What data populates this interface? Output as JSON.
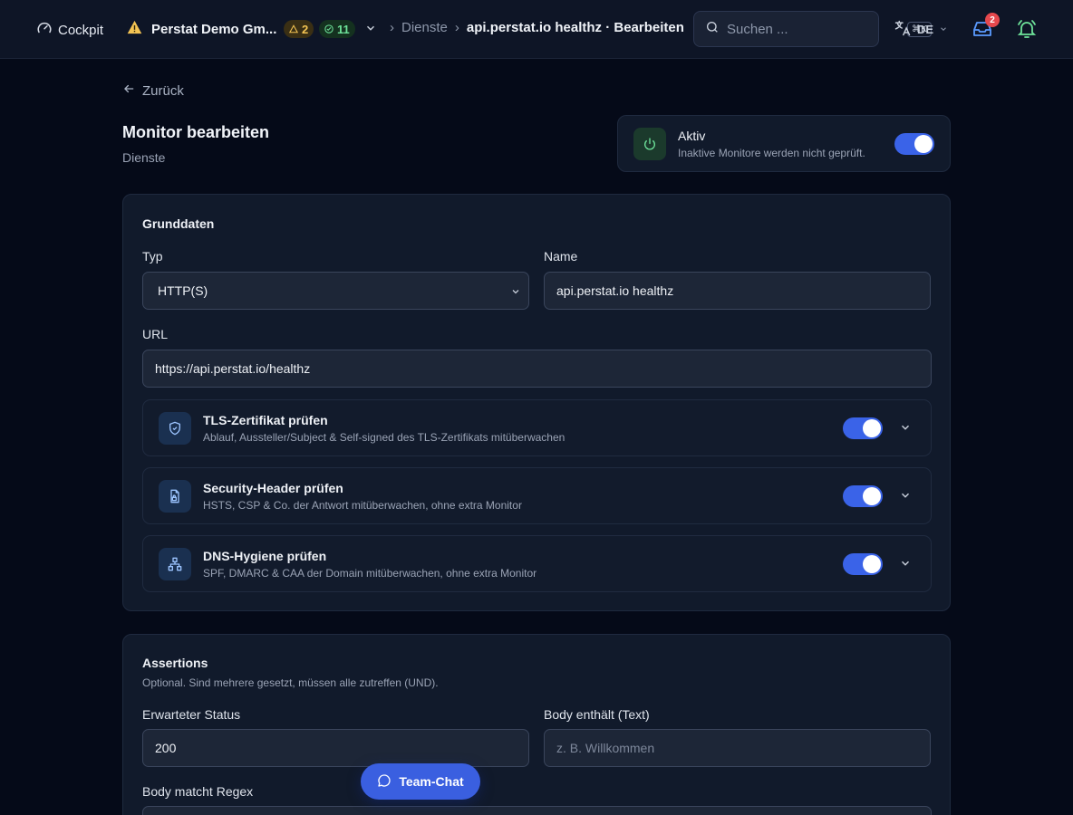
{
  "topbar": {
    "cockpit_label": "Cockpit",
    "org_name": "Perstat Demo Gm...",
    "warn_count": "2",
    "ok_count": "11",
    "crumb_parent": "Dienste",
    "crumb_current": "api.perstat.io healthz · Bearbeiten",
    "search_placeholder": "Suchen ...",
    "search_shortcut": "⌘K",
    "lang": "DE",
    "inbox_count": "2"
  },
  "page": {
    "back_label": "Zurück",
    "title": "Monitor bearbeiten",
    "subtitle": "Dienste"
  },
  "active": {
    "label": "Aktiv",
    "description": "Inaktive Monitore werden nicht geprüft.",
    "enabled": true
  },
  "basic": {
    "title": "Grunddaten",
    "type_label": "Typ",
    "type_value": "HTTP(S)",
    "name_label": "Name",
    "name_value": "api.perstat.io healthz",
    "url_label": "URL",
    "url_value": "https://api.perstat.io/healthz",
    "checks": [
      {
        "title": "TLS-Zertifikat prüfen",
        "description": "Ablauf, Aussteller/Subject & Self-signed des TLS-Zertifikats mitüberwachen",
        "icon": "shield-icon",
        "enabled": true
      },
      {
        "title": "Security-Header prüfen",
        "description": "HSTS, CSP & Co. der Antwort mitüberwachen, ohne extra Monitor",
        "icon": "file-lock-icon",
        "enabled": true
      },
      {
        "title": "DNS-Hygiene prüfen",
        "description": "SPF, DMARC & CAA der Domain mitüberwachen, ohne extra Monitor",
        "icon": "network-icon",
        "enabled": true
      }
    ]
  },
  "assertions": {
    "title": "Assertions",
    "subtitle": "Optional. Sind mehrere gesetzt, müssen alle zutreffen (UND).",
    "status_label": "Erwarteter Status",
    "status_value": "200",
    "body_contains_label": "Body enthält (Text)",
    "body_contains_placeholder": "z. B. Willkommen",
    "body_regex_label": "Body matcht Regex"
  },
  "chat": {
    "label": "Team-Chat"
  },
  "colors": {
    "accent": "#3a63e8",
    "background": "#050a18",
    "card": "#111a2b"
  }
}
